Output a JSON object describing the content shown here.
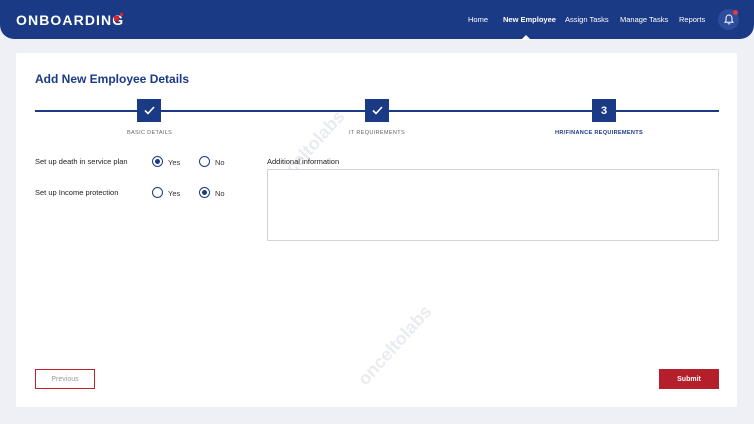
{
  "app": {
    "brand": "ONBOARDING"
  },
  "nav": {
    "items": [
      {
        "label": "Home"
      },
      {
        "label": "New Employee",
        "active": true
      },
      {
        "label": "Assign Tasks"
      },
      {
        "label": "Manage Tasks"
      },
      {
        "label": "Reports"
      }
    ]
  },
  "page": {
    "title": "Add New Employee Details"
  },
  "stepper": {
    "steps": [
      {
        "label": "BASIC DETAILS",
        "status": "done"
      },
      {
        "label": "IT REQUIREMENTS",
        "status": "done"
      },
      {
        "label": "HR/FINANCE REQUIREMENTS",
        "number": "3",
        "status": "current"
      }
    ]
  },
  "form": {
    "questions": [
      {
        "label": "Set up death in service plan",
        "yes": "Yes",
        "no": "No",
        "selected": "yes"
      },
      {
        "label": "Set up Income protection",
        "yes": "Yes",
        "no": "No",
        "selected": "no"
      }
    ],
    "additional_label": "Additional information",
    "additional_value": ""
  },
  "actions": {
    "previous": "Previous",
    "submit": "Submit"
  },
  "watermark": "onceltolabs",
  "colors": {
    "primary": "#1b3a86",
    "accent": "#b51f2c",
    "background": "#eef0f6"
  }
}
